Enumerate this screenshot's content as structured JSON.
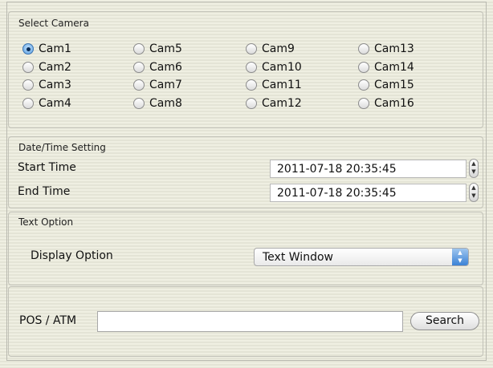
{
  "select_camera": {
    "title": "Select Camera",
    "selected": "Cam1",
    "cameras": [
      "Cam1",
      "Cam5",
      "Cam9",
      "Cam13",
      "Cam2",
      "Cam6",
      "Cam10",
      "Cam14",
      "Cam3",
      "Cam7",
      "Cam11",
      "Cam15",
      "Cam4",
      "Cam8",
      "Cam12",
      "Cam16"
    ]
  },
  "datetime": {
    "title": "Date/Time Setting",
    "start_label": "Start Time",
    "start_value": "2011-07-18 20:35:45",
    "end_label": "End Time",
    "end_value": "2011-07-18 20:35:45"
  },
  "text_option": {
    "title": "Text Option",
    "display_label": "Display Option",
    "display_value": "Text Window"
  },
  "pos": {
    "label": "POS / ATM",
    "input_value": "",
    "search_label": "Search"
  },
  "icons": {
    "stepper": "up-down-stepper-icon",
    "select": "up-down-arrows-icon"
  }
}
